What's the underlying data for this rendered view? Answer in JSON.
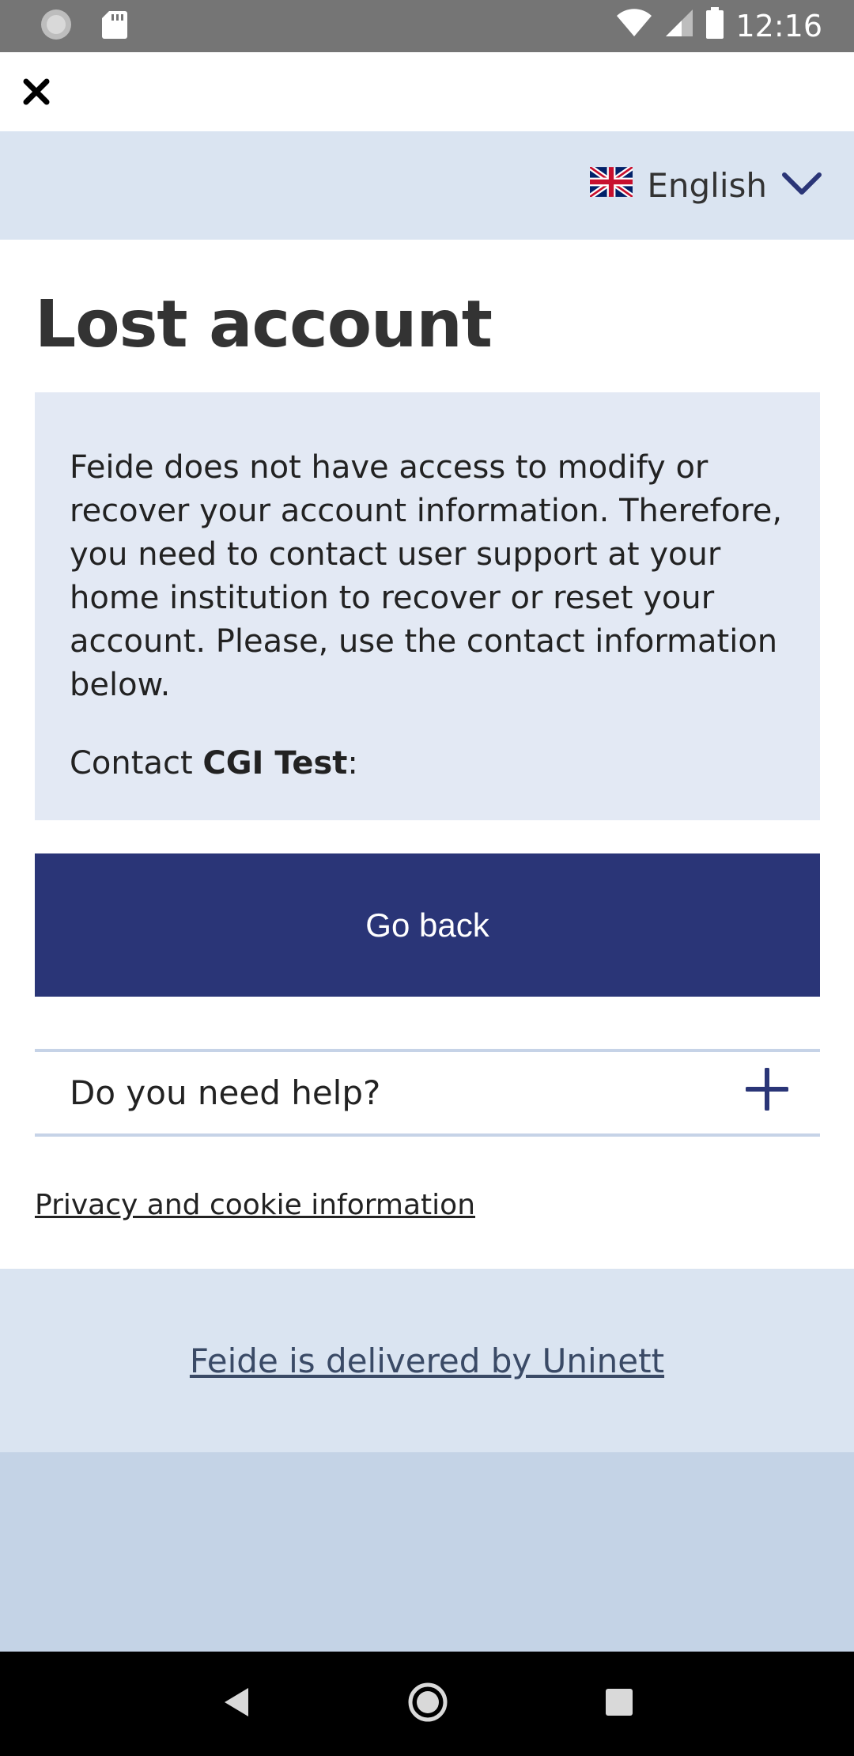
{
  "status_bar": {
    "time": "12:16",
    "icons": [
      "record-icon",
      "sd-card-icon",
      "wifi-icon",
      "cellular-signal-icon",
      "battery-icon"
    ]
  },
  "top_bar": {
    "close_icon": "close-icon"
  },
  "language": {
    "selected": "English",
    "flag_icon": "uk-flag-icon"
  },
  "main": {
    "title": "Lost account",
    "info_text": "Feide does not have access to modify or recover your account information. Therefore, you need to contact user support at your home institution to recover or reset your account. Please, use the contact information below.",
    "contact_prefix": "Contact ",
    "contact_org": "CGI Test",
    "contact_suffix": ":",
    "go_back_label": "Go back",
    "help_label": "Do you need help?",
    "privacy_link": "Privacy and cookie information"
  },
  "footer": {
    "delivered_by": "Feide is delivered by Uninett"
  },
  "colors": {
    "primary": "#2a3577",
    "light_blue": "#dae4f1",
    "info_bg": "#e3e9f4",
    "page_bottom": "#c4d3e6"
  }
}
